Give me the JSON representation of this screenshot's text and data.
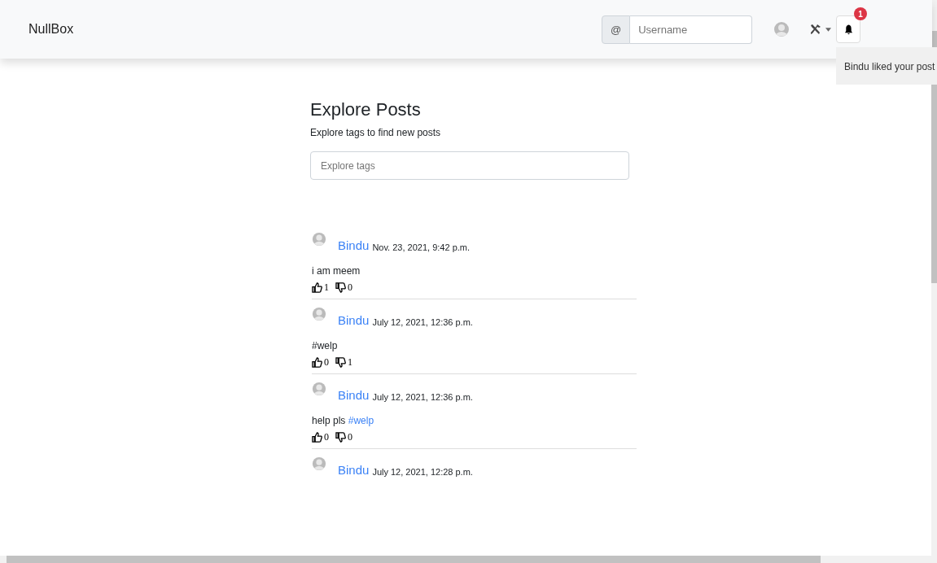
{
  "navbar": {
    "brand": "NullBox",
    "search": {
      "prefix": "@",
      "placeholder": "Username"
    },
    "notifications": {
      "count": "1",
      "items": [
        "Bindu liked your post"
      ]
    }
  },
  "header": {
    "title": "Explore Posts",
    "subtitle": "Explore tags to find new posts",
    "tag_search": {
      "placeholder": "Explore tags"
    }
  },
  "posts": [
    {
      "author": "Bindu",
      "date": "Nov. 23, 2021, 9:42 p.m.",
      "body": [
        {
          "kind": "text",
          "text": "i am meem"
        }
      ],
      "likes": "1",
      "dislikes": "0"
    },
    {
      "author": "Bindu",
      "date": "July 12, 2021, 12:36 p.m.",
      "body": [
        {
          "kind": "text",
          "text": "#welp"
        }
      ],
      "likes": "0",
      "dislikes": "1"
    },
    {
      "author": "Bindu",
      "date": "July 12, 2021, 12:36 p.m.",
      "body": [
        {
          "kind": "text",
          "text": "help pls "
        },
        {
          "kind": "tag",
          "text": "#welp"
        }
      ],
      "likes": "0",
      "dislikes": "0"
    },
    {
      "author": "Bindu",
      "date": "July 12, 2021, 12:28 p.m."
    }
  ]
}
